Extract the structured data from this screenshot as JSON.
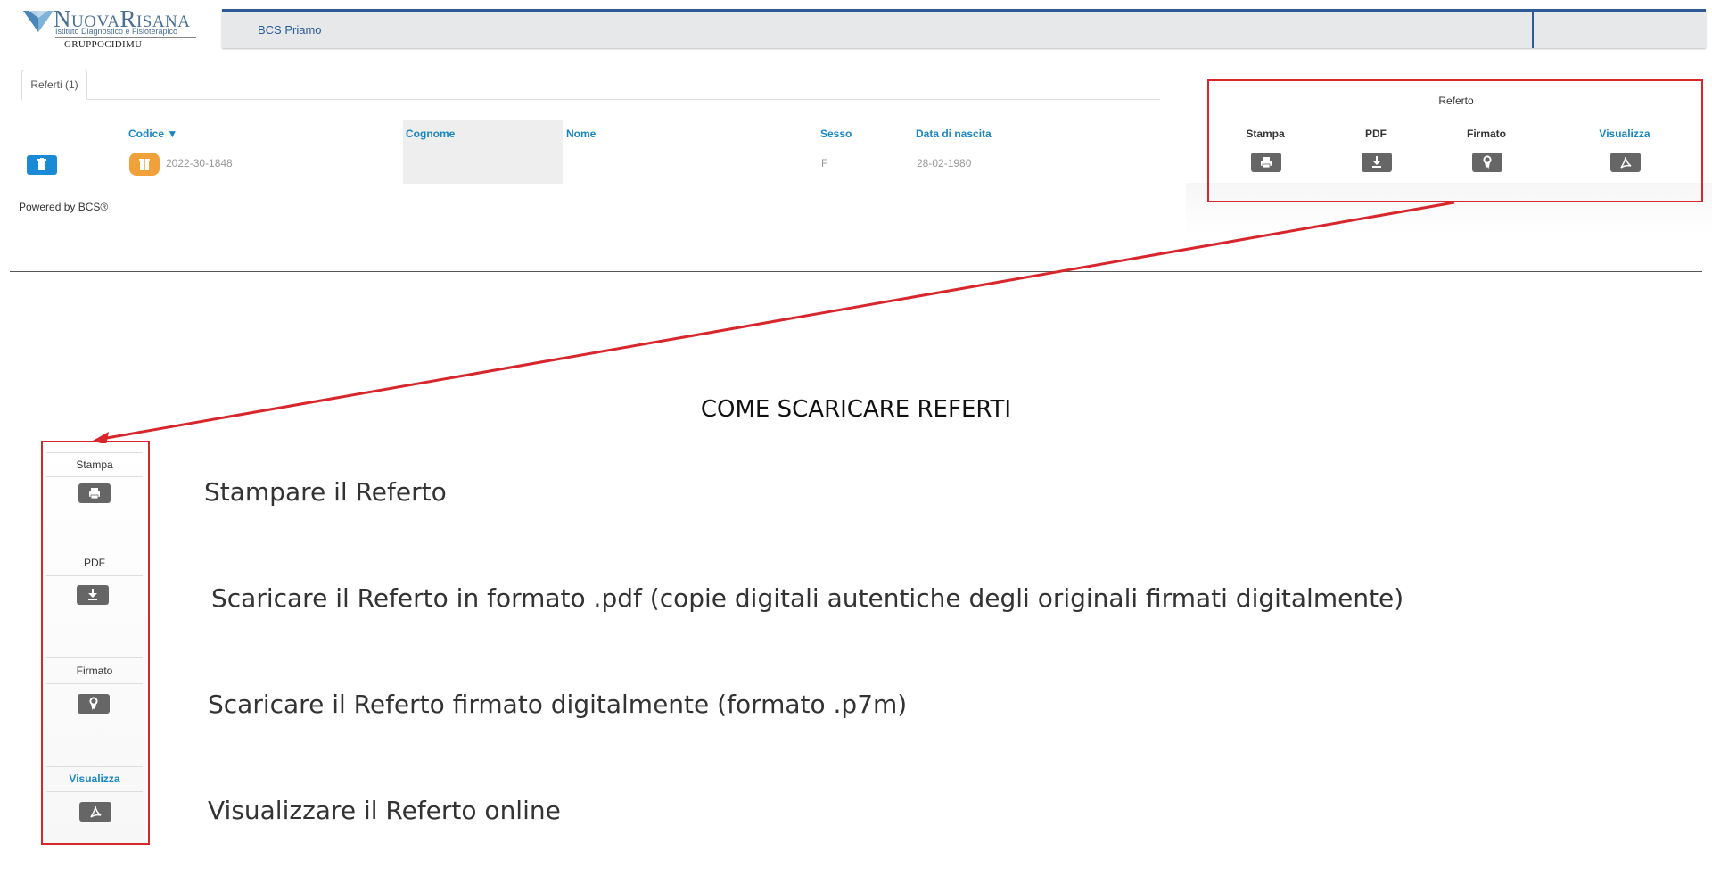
{
  "logo": {
    "name_part1": "Nuova",
    "name_part2": "Risana",
    "subtitle": "Istituto Diagnostico e Fisioterapico",
    "group": "GRUPPOCIDIMU"
  },
  "header": {
    "title": "BCS Priamo"
  },
  "tabs": [
    {
      "label": "Referti (1)"
    }
  ],
  "table": {
    "referto_group_label": "Referto",
    "columns": {
      "codice": "Codice ▼",
      "cognome": "Cognome",
      "nome": "Nome",
      "sesso": "Sesso",
      "data_nascita": "Data di nascita",
      "stampa": "Stampa",
      "pdf": "PDF",
      "firmato": "Firmato",
      "visualizza": "Visualizza"
    },
    "rows": [
      {
        "codice": "2022-30-1848",
        "cognome": "",
        "nome": "",
        "sesso": "F",
        "data_nascita": "28-02-1980"
      }
    ]
  },
  "footer": {
    "powered": "Powered by BCS®"
  },
  "guide": {
    "title": "COME SCARICARE REFERTI",
    "items": [
      {
        "label": "Stampa",
        "icon": "print-icon",
        "description": "Stampare il Referto"
      },
      {
        "label": "PDF",
        "icon": "download-icon",
        "description": "Scaricare il Referto in formato .pdf (copie digitali autentiche degli originali firmati digitalmente)"
      },
      {
        "label": "Firmato",
        "icon": "certificate-icon",
        "description": "Scaricare il Referto firmato digitalmente (formato .p7m)"
      },
      {
        "label": "Visualizza",
        "icon": "pdf-view-icon",
        "description": "Visualizzare il Referto online"
      }
    ]
  },
  "colors": {
    "accent_blue": "#1a86c4",
    "header_blue": "#2f5b95",
    "annotation_red": "#d7262c",
    "code_badge": "#f0a13a",
    "action_grey": "#666666"
  }
}
